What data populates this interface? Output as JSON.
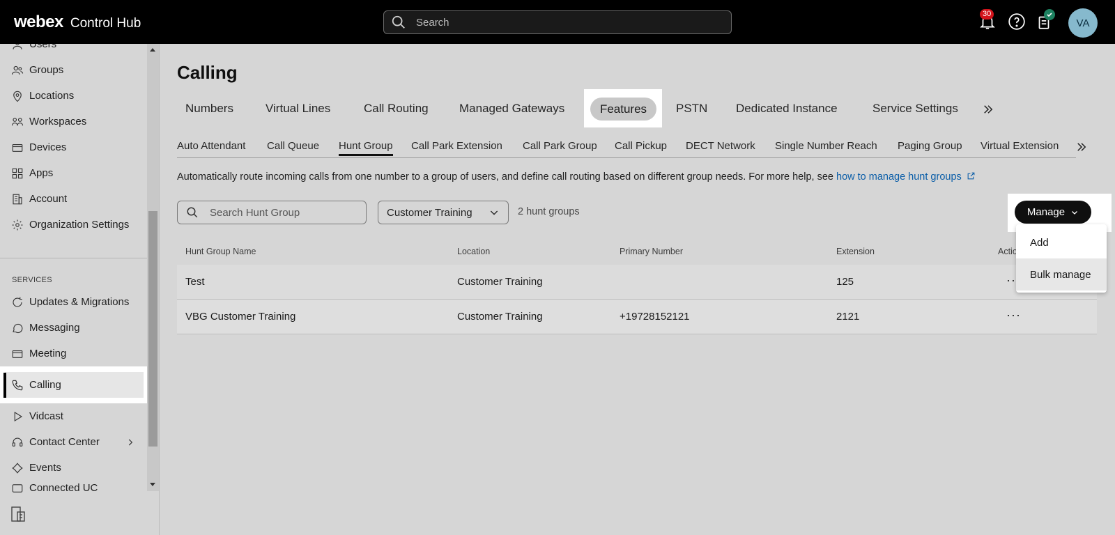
{
  "app": {
    "brand": "webex",
    "product": "Control Hub"
  },
  "header": {
    "search_placeholder": "Search",
    "notifications_count": "30",
    "avatar_initials": "VA"
  },
  "sidebar": {
    "items_top": [
      "Users",
      "Groups",
      "Locations",
      "Workspaces",
      "Devices",
      "Apps",
      "Account",
      "Organization Settings"
    ],
    "section_label": "SERVICES",
    "items_services": [
      "Updates & Migrations",
      "Messaging",
      "Meeting",
      "Calling",
      "Vidcast",
      "Contact Center",
      "Events",
      "Connected UC"
    ],
    "active_item": "Calling"
  },
  "page": {
    "title": "Calling",
    "tabs": [
      "Numbers",
      "Virtual Lines",
      "Call Routing",
      "Managed Gateways",
      "Features",
      "PSTN",
      "Dedicated Instance",
      "Service Settings"
    ],
    "active_tab": "Features",
    "subtabs": [
      "Auto Attendant",
      "Call Queue",
      "Hunt Group",
      "Call Park Extension",
      "Call Park Group",
      "Call Pickup",
      "DECT Network",
      "Single Number Reach",
      "Paging Group",
      "Virtual Extension"
    ],
    "active_subtab": "Hunt Group",
    "description": "Automatically route incoming calls from one number to a group of users, and define call routing based on different group needs. For more help, see ",
    "help_link": "how to manage hunt groups",
    "search_placeholder": "Search Hunt Group",
    "location_filter": "Customer Training",
    "count_text": "2 hunt groups",
    "manage_label": "Manage",
    "manage_menu": [
      "Add",
      "Bulk manage"
    ]
  },
  "table": {
    "columns": [
      "Hunt Group Name",
      "Location",
      "Primary Number",
      "Extension",
      "Actio"
    ],
    "rows": [
      {
        "name": "Test",
        "location": "Customer Training",
        "number": "",
        "extension": "125"
      },
      {
        "name": "VBG Customer Training",
        "location": "Customer Training",
        "number": "+19728152121",
        "extension": "2121"
      }
    ]
  },
  "colors": {
    "link": "#0b5ea8",
    "badge": "#d3131b",
    "avatar": "#86b9cd",
    "status_ok": "#1d8160"
  }
}
